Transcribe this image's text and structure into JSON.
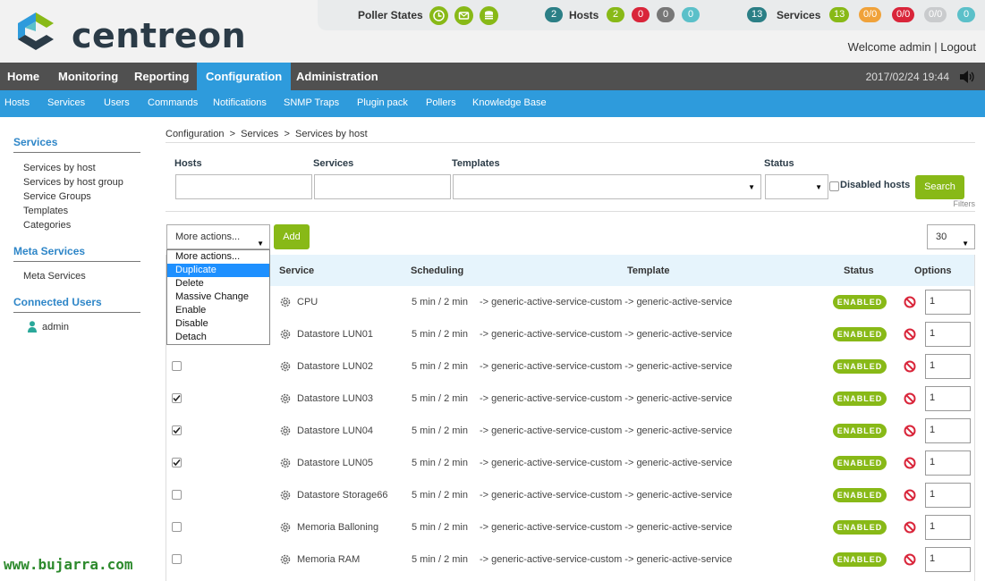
{
  "brand": {
    "name": "centreon"
  },
  "status_bar": {
    "poller_states_label": "Poller States",
    "hosts": {
      "total": "2",
      "label": "Hosts",
      "up": "2",
      "down": "0",
      "unreachable": "0",
      "pending": "0"
    },
    "services": {
      "total": "13",
      "label": "Services",
      "ok": "13",
      "warning": "0/0",
      "critical": "0/0",
      "unknown": "0/0",
      "pending": "0"
    }
  },
  "user": {
    "welcome": "Welcome admin",
    "separator": " | ",
    "logout": "Logout"
  },
  "menu": [
    "Home",
    "Monitoring",
    "Reporting",
    "Configuration",
    "Administration"
  ],
  "datetime": "2017/02/24 19:44",
  "submenu": [
    "Hosts",
    "Services",
    "Users",
    "Commands",
    "Notifications",
    "SNMP Traps",
    "Plugin pack",
    "Pollers",
    "Knowledge Base"
  ],
  "sidebar": {
    "sections": [
      {
        "title": "Services",
        "items": [
          "Services by host",
          "Services by host group",
          "Service Groups",
          "Templates",
          "Categories"
        ]
      },
      {
        "title": "Meta Services",
        "items": [
          "Meta Services"
        ]
      },
      {
        "title": "Connected Users",
        "items": [
          "admin"
        ]
      }
    ]
  },
  "breadcrumb": {
    "part1": "Configuration",
    "sep": ">",
    "part2": "Services",
    "part3": "Services by host"
  },
  "filters": {
    "hosts_label": "Hosts",
    "services_label": "Services",
    "templates_label": "Templates",
    "status_label": "Status",
    "disabled_hosts_label": "Disabled hosts",
    "search_label": "Search",
    "filters_label": "Filters"
  },
  "actions": {
    "more_actions": "More actions...",
    "add": "Add",
    "page_size": "30",
    "dropdown_options": [
      "More actions...",
      "Duplicate",
      "Delete",
      "Massive Change",
      "Enable",
      "Disable",
      "Detach"
    ],
    "highlighted_option": "Duplicate"
  },
  "table": {
    "headers": {
      "service": "Service",
      "scheduling": "Scheduling",
      "template": "Template",
      "status": "Status",
      "options": "Options"
    },
    "rows": [
      {
        "service": "CPU",
        "scheduling": "5 min / 2 min",
        "template": "-> generic-active-service-custom -> generic-active-service",
        "status": "ENABLED",
        "option": "1",
        "checked": false
      },
      {
        "service": "Datastore LUN01",
        "scheduling": "5 min / 2 min",
        "template": "-> generic-active-service-custom -> generic-active-service",
        "status": "ENABLED",
        "option": "1",
        "checked": false
      },
      {
        "service": "Datastore LUN02",
        "scheduling": "5 min / 2 min",
        "template": "-> generic-active-service-custom -> generic-active-service",
        "status": "ENABLED",
        "option": "1",
        "checked": false
      },
      {
        "service": "Datastore LUN03",
        "scheduling": "5 min / 2 min",
        "template": "-> generic-active-service-custom -> generic-active-service",
        "status": "ENABLED",
        "option": "1",
        "checked": true
      },
      {
        "service": "Datastore LUN04",
        "scheduling": "5 min / 2 min",
        "template": "-> generic-active-service-custom -> generic-active-service",
        "status": "ENABLED",
        "option": "1",
        "checked": true
      },
      {
        "service": "Datastore LUN05",
        "scheduling": "5 min / 2 min",
        "template": "-> generic-active-service-custom -> generic-active-service",
        "status": "ENABLED",
        "option": "1",
        "checked": true
      },
      {
        "service": "Datastore Storage66",
        "scheduling": "5 min / 2 min",
        "template": "-> generic-active-service-custom -> generic-active-service",
        "status": "ENABLED",
        "option": "1",
        "checked": false
      },
      {
        "service": "Memoria Balloning",
        "scheduling": "5 min / 2 min",
        "template": "-> generic-active-service-custom -> generic-active-service",
        "status": "ENABLED",
        "option": "1",
        "checked": false
      },
      {
        "service": "Memoria RAM",
        "scheduling": "5 min / 2 min",
        "template": "-> generic-active-service-custom -> generic-active-service",
        "status": "ENABLED",
        "option": "1",
        "checked": false
      }
    ]
  },
  "watermark": "www.bujarra.com",
  "colors": {
    "accent_blue": "#2e9bdc",
    "menu_dark": "#505050",
    "green": "#88b917",
    "teal": "#5bc0c9",
    "red": "#d9253a",
    "grey": "#777777",
    "orange": "#f0a23a"
  }
}
